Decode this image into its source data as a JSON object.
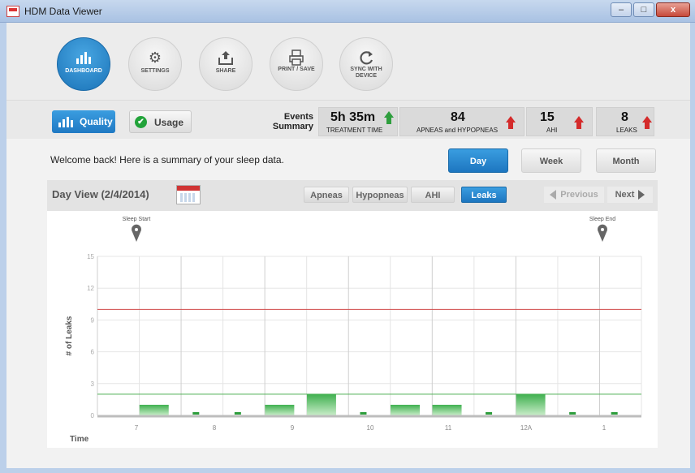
{
  "window": {
    "title": "HDM Data Viewer",
    "minimize": "–",
    "maximize": "□",
    "close": "x"
  },
  "nav": {
    "buttons": [
      {
        "label": "DASHBOARD",
        "icon": "bar-chart-icon",
        "active": true
      },
      {
        "label": "SETTINGS",
        "icon": "gear-icon",
        "active": false
      },
      {
        "label": "SHARE",
        "icon": "share-upload-icon",
        "active": false
      },
      {
        "label": "PRINT / SAVE",
        "icon": "printer-icon",
        "active": false
      },
      {
        "label": "SYNC WITH DEVICE",
        "icon": "sync-icon",
        "active": false
      }
    ]
  },
  "tabs": {
    "quality": "Quality",
    "usage": "Usage"
  },
  "summary": {
    "label": "Events Summary",
    "treatment": {
      "value": "5h 35m",
      "caption": "TREATMENT TIME",
      "trend": "up",
      "color": "#2e9e3d"
    },
    "apneas": {
      "value": "84",
      "caption": "APNEAS and HYPOPNEAS",
      "trend": "up",
      "color": "#d42b2b"
    },
    "ahi": {
      "value": "15",
      "caption": "AHI",
      "trend": "up",
      "color": "#d42b2b"
    },
    "leaks": {
      "value": "8",
      "caption": "LEAKS",
      "trend": "up",
      "color": "#d42b2b"
    }
  },
  "welcome": "Welcome back! Here is a summary of your sleep data.",
  "periods": {
    "day": "Day",
    "week": "Week",
    "month": "Month",
    "selected": "Day"
  },
  "day_view": {
    "title": "Day View (2/4/2014)",
    "filters": [
      "Apneas",
      "Hypopneas",
      "AHI",
      "Leaks"
    ],
    "selected_filter": "Leaks",
    "previous": "Previous",
    "next": "Next"
  },
  "chart_data": {
    "type": "bar",
    "ylabel": "# of Leaks",
    "xlabel": "Time",
    "ylim": [
      0,
      15
    ],
    "yticks": [
      0,
      3,
      6,
      9,
      12,
      15
    ],
    "x_tick_labels": [
      "7",
      "8",
      "9",
      "10",
      "11",
      "12A",
      "1"
    ],
    "values": [
      1,
      0,
      0,
      1,
      2,
      0,
      1,
      1,
      0,
      2,
      0,
      0,
      0
    ],
    "threshold_red": 10,
    "threshold_green": 2,
    "sleep_start": "Sleep Start",
    "sleep_end": "Sleep End",
    "grid": true
  }
}
